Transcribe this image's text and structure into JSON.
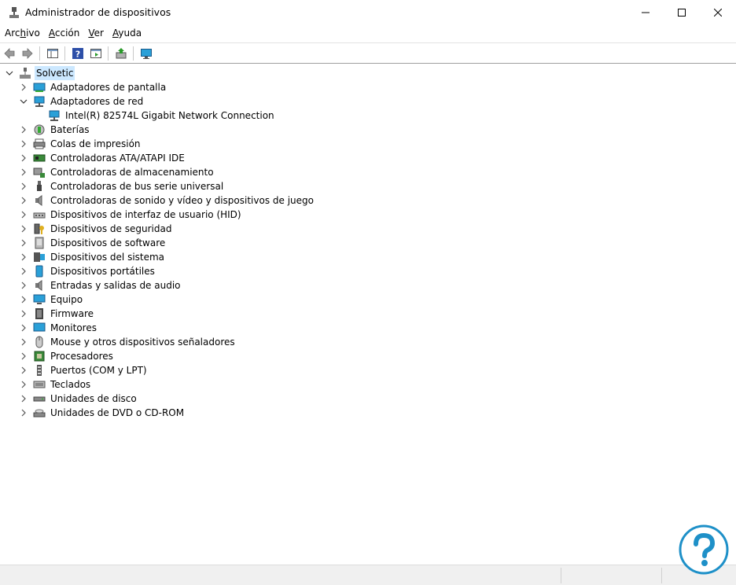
{
  "window": {
    "title": "Administrador de dispositivos",
    "icon": "device-manager-icon"
  },
  "menu": [
    {
      "prefix": "Arc",
      "accel": "h",
      "suffix": "ivo"
    },
    {
      "prefix": "",
      "accel": "A",
      "suffix": "cción"
    },
    {
      "prefix": "",
      "accel": "V",
      "suffix": "er"
    },
    {
      "prefix": "",
      "accel": "A",
      "suffix": "yuda"
    }
  ],
  "tree": {
    "root": {
      "label": "Solvetic",
      "expanded": true,
      "selected": true
    },
    "nodes": [
      {
        "label": "Adaptadores de pantalla",
        "icon": "display-adapter-icon",
        "expanded": false
      },
      {
        "label": "Adaptadores de red",
        "icon": "network-adapter-icon",
        "expanded": true,
        "children": [
          {
            "label": "Intel(R) 82574L Gigabit Network Connection",
            "icon": "network-adapter-icon"
          }
        ]
      },
      {
        "label": "Baterías",
        "icon": "battery-icon",
        "expanded": false
      },
      {
        "label": "Colas de impresión",
        "icon": "printer-icon",
        "expanded": false
      },
      {
        "label": "Controladoras ATA/ATAPI IDE",
        "icon": "ide-controller-icon",
        "expanded": false
      },
      {
        "label": "Controladoras de almacenamiento",
        "icon": "storage-controller-icon",
        "expanded": false
      },
      {
        "label": "Controladoras de bus serie universal",
        "icon": "usb-icon",
        "expanded": false
      },
      {
        "label": "Controladoras de sonido y vídeo y dispositivos de juego",
        "icon": "speaker-icon",
        "expanded": false
      },
      {
        "label": "Dispositivos de interfaz de usuario (HID)",
        "icon": "hid-icon",
        "expanded": false
      },
      {
        "label": "Dispositivos de seguridad",
        "icon": "security-key-icon",
        "expanded": false
      },
      {
        "label": "Dispositivos de software",
        "icon": "software-device-icon",
        "expanded": false
      },
      {
        "label": "Dispositivos del sistema",
        "icon": "system-device-icon",
        "expanded": false
      },
      {
        "label": "Dispositivos portátiles",
        "icon": "portable-device-icon",
        "expanded": false
      },
      {
        "label": "Entradas y salidas de audio",
        "icon": "speaker-icon",
        "expanded": false
      },
      {
        "label": "Equipo",
        "icon": "computer-icon",
        "expanded": false
      },
      {
        "label": "Firmware",
        "icon": "firmware-icon",
        "expanded": false
      },
      {
        "label": "Monitores",
        "icon": "monitor-icon",
        "expanded": false
      },
      {
        "label": "Mouse y otros dispositivos señaladores",
        "icon": "mouse-icon",
        "expanded": false
      },
      {
        "label": "Procesadores",
        "icon": "processor-icon",
        "expanded": false
      },
      {
        "label": "Puertos (COM y LPT)",
        "icon": "port-icon",
        "expanded": false
      },
      {
        "label": "Teclados",
        "icon": "keyboard-icon",
        "expanded": false
      },
      {
        "label": "Unidades de disco",
        "icon": "disk-drive-icon",
        "expanded": false
      },
      {
        "label": "Unidades de DVD o CD-ROM",
        "icon": "dvd-drive-icon",
        "expanded": false
      }
    ]
  },
  "colors": {
    "selection": "#cce8ff",
    "accent": "#1e90c8"
  }
}
